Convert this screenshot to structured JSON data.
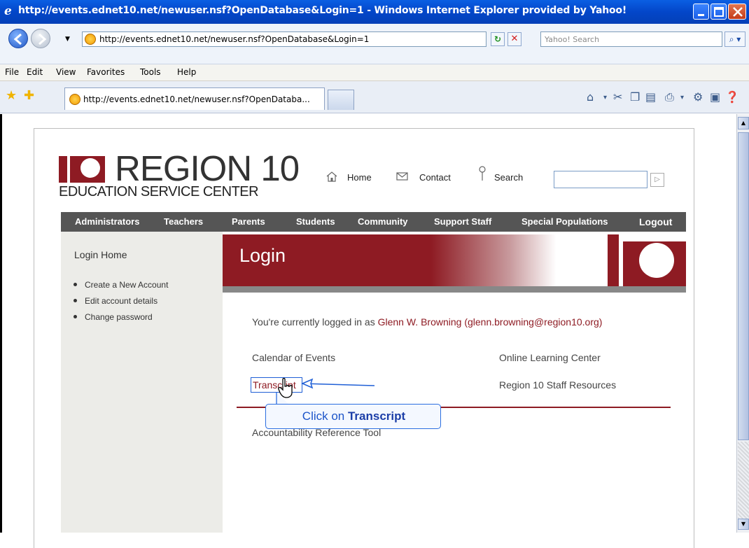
{
  "window": {
    "title": "http://events.ednet10.net/newuser.nsf?OpenDatabase&Login=1 - Windows Internet Explorer provided by Yahoo!"
  },
  "address_bar": {
    "url": "http://events.ednet10.net/newuser.nsf?OpenDatabase&Login=1",
    "search_placeholder": "Yahoo! Search"
  },
  "menu": [
    "File",
    "Edit",
    "View",
    "Favorites",
    "Tools",
    "Help"
  ],
  "tab": {
    "label": "http://events.ednet10.net/newuser.nsf?OpenDataba..."
  },
  "site": {
    "logo_title": "REGION 10",
    "logo_subtitle": "EDUCATION SERVICE CENTER",
    "top_links": {
      "home": "Home",
      "contact": "Contact",
      "search": "Search"
    },
    "nav": [
      "Administrators",
      "Teachers",
      "Parents",
      "Students",
      "Community",
      "Support Staff",
      "Special Populations",
      "Logout"
    ],
    "brand_color": "#8e1b23"
  },
  "sidebar": {
    "title": "Login Home",
    "links": [
      "Create a New Account",
      "Edit account details",
      "Change password"
    ]
  },
  "banner": {
    "title": "Login"
  },
  "main": {
    "logged_in_prefix": "You're currently logged in as ",
    "logged_in_user": "Glenn W. Browning (glenn.browning@region10.org)",
    "links": {
      "calendar": "Calendar of Events",
      "online_learning": "Online Learning Center",
      "transcript": "Transcript",
      "staff_resources": "Region 10 Staff Resources",
      "accountability": "Accountability Reference Tool"
    }
  },
  "callout": {
    "prefix": "Click on ",
    "target": "Transcript"
  }
}
